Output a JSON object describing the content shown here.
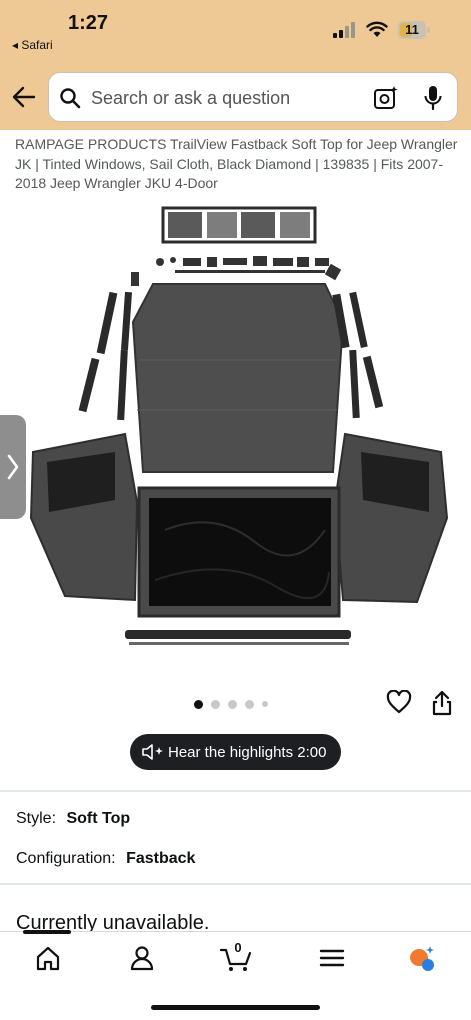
{
  "status": {
    "time": "1:27",
    "back_app": "◂ Safari",
    "battery": "11"
  },
  "search": {
    "placeholder": "Search or ask a question"
  },
  "product": {
    "title": "RAMPAGE PRODUCTS TrailView Fastback Soft Top for Jeep Wrangler JK | Tinted Windows, Sail Cloth, Black Diamond | 139835 | Fits 2007-2018 Jeep Wrangler JKU 4-Door",
    "image_count": 5,
    "active_image": 1
  },
  "highlights": {
    "label": "Hear the highlights 2:00"
  },
  "style": {
    "label": "Style:",
    "value": "Soft Top"
  },
  "configuration": {
    "label": "Configuration:",
    "value": "Fastback"
  },
  "availability": {
    "text": "Currently unavailable."
  },
  "tabbar": {
    "cart_count": "0",
    "tabs": [
      "home",
      "account",
      "cart",
      "menu",
      "rufus"
    ]
  },
  "colors": {
    "header_bg": "#efc995",
    "accent": "#1d1f22"
  }
}
